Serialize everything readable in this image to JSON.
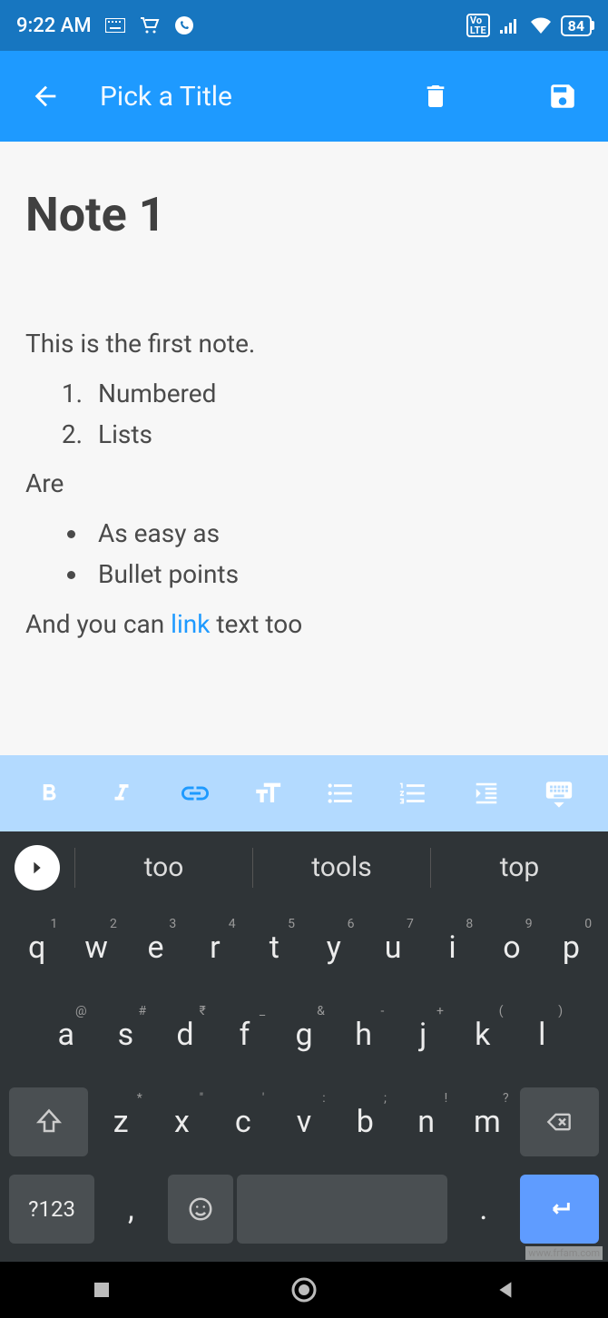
{
  "status": {
    "time": "9:22 AM",
    "battery": "84"
  },
  "appbar": {
    "title_placeholder": "Pick a Title"
  },
  "note": {
    "title": "Note 1",
    "body": {
      "intro": "This is the first note.",
      "ordered": [
        "Numbered",
        "Lists"
      ],
      "mid": "Are",
      "bullets": [
        "As easy as",
        "Bullet points"
      ],
      "outro_pre": "And you can ",
      "link_text": "link",
      "outro_post": " text too"
    }
  },
  "format_toolbar": {
    "items": [
      "bold",
      "italic",
      "link",
      "text-size",
      "bulleted-list",
      "numbered-list",
      "indent",
      "keyboard-hide"
    ],
    "active": "link"
  },
  "keyboard": {
    "suggestions": [
      "too",
      "tools",
      "top"
    ],
    "row1": [
      {
        "k": "q",
        "s": "1"
      },
      {
        "k": "w",
        "s": "2"
      },
      {
        "k": "e",
        "s": "3"
      },
      {
        "k": "r",
        "s": "4"
      },
      {
        "k": "t",
        "s": "5"
      },
      {
        "k": "y",
        "s": "6"
      },
      {
        "k": "u",
        "s": "7"
      },
      {
        "k": "i",
        "s": "8"
      },
      {
        "k": "o",
        "s": "9"
      },
      {
        "k": "p",
        "s": "0"
      }
    ],
    "row2": [
      {
        "k": "a",
        "s": "@"
      },
      {
        "k": "s",
        "s": "#"
      },
      {
        "k": "d",
        "s": "₹"
      },
      {
        "k": "f",
        "s": "_"
      },
      {
        "k": "g",
        "s": "&"
      },
      {
        "k": "h",
        "s": "-"
      },
      {
        "k": "j",
        "s": "+"
      },
      {
        "k": "k",
        "s": "("
      },
      {
        "k": "l",
        "s": ")"
      }
    ],
    "row3": [
      {
        "k": "z",
        "s": "*"
      },
      {
        "k": "x",
        "s": "\""
      },
      {
        "k": "c",
        "s": "'"
      },
      {
        "k": "v",
        "s": ":"
      },
      {
        "k": "b",
        "s": ";"
      },
      {
        "k": "n",
        "s": "!"
      },
      {
        "k": "m",
        "s": "?"
      }
    ],
    "symkey": "?123",
    "comma": ",",
    "period": "."
  },
  "watermark": "www.frfam.com"
}
